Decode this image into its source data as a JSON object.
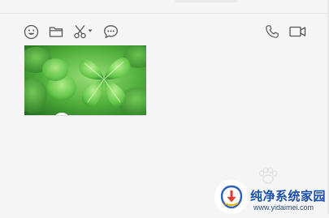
{
  "toolbar": {
    "icons": [
      "emoji-icon",
      "folder-icon",
      "scissors-icon",
      "chevron-down-icon",
      "chat-bubble-icon",
      "phone-icon",
      "video-icon"
    ]
  },
  "message": {
    "image": "four-leaf-clover-photo"
  },
  "watermark": {
    "title": "纯净系统家园",
    "url": "www.yidaimei.com"
  },
  "colors": {
    "background": "#f5f5f5",
    "icon": "#555555",
    "watermark_blue": "#1b4fa8",
    "clover_green": "#5cc24a"
  }
}
